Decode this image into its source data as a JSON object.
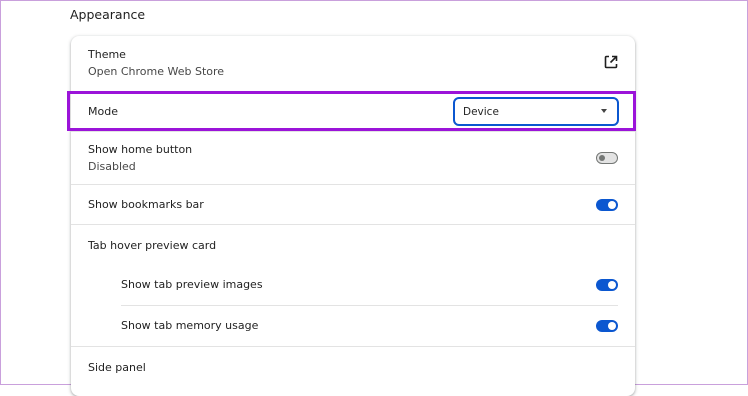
{
  "section_title": "Appearance",
  "theme": {
    "label": "Theme",
    "sublabel": "Open Chrome Web Store",
    "icon": "open-in-new-icon"
  },
  "mode": {
    "label": "Mode",
    "selected": "Device"
  },
  "home_button": {
    "label": "Show home button",
    "sublabel": "Disabled",
    "enabled": false
  },
  "bookmarks_bar": {
    "label": "Show bookmarks bar",
    "enabled": true
  },
  "tab_hover": {
    "label": "Tab hover preview card",
    "preview_images": {
      "label": "Show tab preview images",
      "enabled": true
    },
    "memory_usage": {
      "label": "Show tab memory usage",
      "enabled": true
    }
  },
  "side_panel": {
    "label": "Side panel"
  },
  "colors": {
    "accent": "#0b57d0",
    "highlight_border": "#9b14d9"
  }
}
